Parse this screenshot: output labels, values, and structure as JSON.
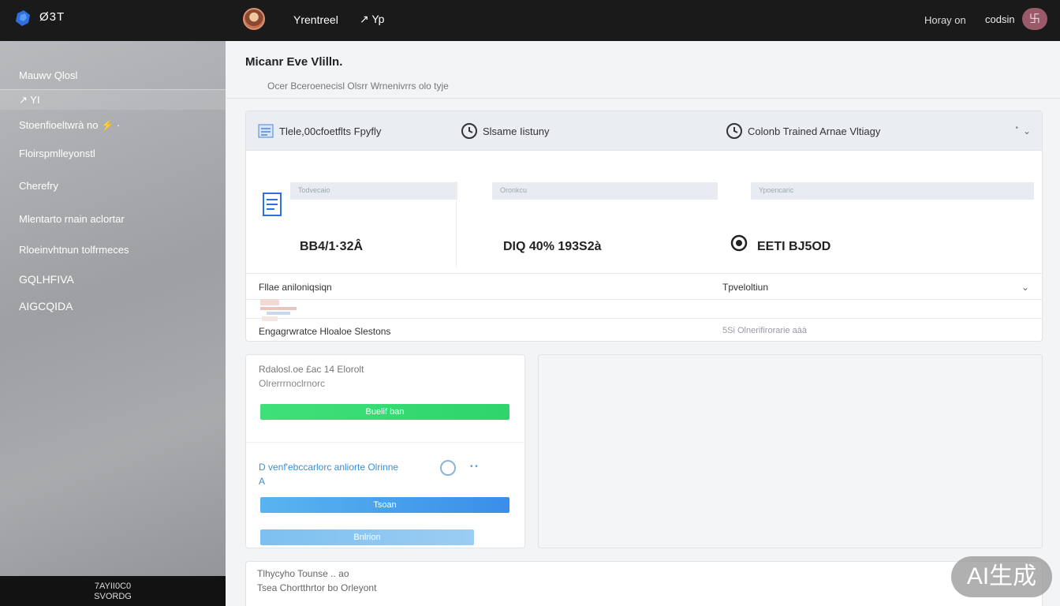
{
  "topbar": {
    "brand": "Ø3T",
    "nav": [
      "Yrentreel",
      "↗ Yp"
    ],
    "right_links": [
      "Horay on",
      "codsin"
    ],
    "avatar_glyph": "࿕"
  },
  "sidebar": {
    "items": [
      {
        "label": "Mauwv Qlosl",
        "active": false
      },
      {
        "label": "↗ YI",
        "active": true
      },
      {
        "label": "Stoenfioeltwrà no  ⚡ ·",
        "active": false
      },
      {
        "label": "Floirspmlleyonstl",
        "active": false
      },
      {
        "label": "Cherefry",
        "active": false
      },
      {
        "label": "Mlentarto rnain aclortar",
        "active": false
      },
      {
        "label": "Rloeinvhtnun tolfrmeces",
        "active": false
      },
      {
        "label": "GQLHFIVA",
        "active": false
      },
      {
        "label": "AIGCQIDA",
        "active": false
      }
    ],
    "footer": [
      "7AYII0C0",
      "SVORDG"
    ]
  },
  "header": {
    "title": "Micanr Eve Vlilln.",
    "subtitle": "Ocer Bceroenecisl  Olsrr Wrnenivrrs   olo tyje"
  },
  "card1": {
    "tabs": [
      {
        "label": "Tlele,00cfoetflts Fpyfly",
        "icon": "list-icon"
      },
      {
        "label": "Slsame Iistuny",
        "icon": "clock-icon"
      },
      {
        "label": "Colonb Trained  Arnae Vltiagy",
        "icon": "clock-icon"
      }
    ],
    "stats": [
      {
        "band_label": "Todvecaio",
        "value": "BB4/1·32Â"
      },
      {
        "band_label": "Oronkcu",
        "value": "DIQ 40% 193S2à"
      },
      {
        "band_label": "Ypoencaric",
        "value": "EETI BJ5OD"
      }
    ],
    "row1": {
      "left": "Fllae  aniloniqsiqn",
      "right": "Tpveloltiun"
    },
    "row2": {
      "left": "Engagrwratce Hloaloe Slestons",
      "right": "5Si Olnerifirorarie aàà"
    }
  },
  "card2": {
    "title": "Rdalosl.oe £ac 14 Elorolt",
    "subtitle": "Olrerrrnoclrnorc",
    "btn_green": "Buelif ban",
    "blue_text": "D venf'ebccarlorc anliorte Olrinne",
    "blue_a": "A",
    "blue_dots": "•  •",
    "btn_blue": "Tsoan",
    "btn_light": "Bnlrion"
  },
  "card4": {
    "title": "Tlhycyho Tounse  .. ao",
    "subtitle": "Tsea Chortthrtor bo Orleyont"
  },
  "watermark": "AI生成",
  "colors": {
    "topbar": "#1a1a1a",
    "green": "#2fd46c",
    "blue": "#3a8ee8",
    "sidebar": "#a5a7aa"
  }
}
